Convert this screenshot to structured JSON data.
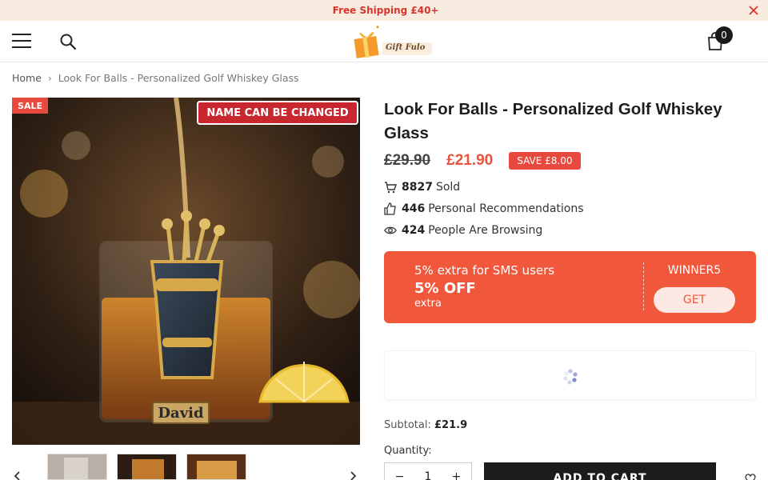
{
  "announcement": {
    "text": "​ Free Shipping £40+"
  },
  "header": {
    "logo_text": "Gift Fulo",
    "cart_count": "0"
  },
  "breadcrumb": {
    "home": "Home",
    "separator": "›",
    "current": "Look For Balls - Personalized Golf Whiskey Glass"
  },
  "product": {
    "sale_badge": "SALE",
    "image_banner": "NAME CAN BE CHANGED",
    "image_name": "David",
    "title": "Look For Balls - Personalized Golf Whiskey Glass",
    "price_old": "£29.90",
    "price_new": "£21.90",
    "save_badge": "SAVE £8.00",
    "stats": [
      {
        "icon": "cart-icon",
        "num": "8827",
        "label": "Sold"
      },
      {
        "icon": "thumbs-up-icon",
        "num": "446",
        "label": "Personal Recommendations"
      },
      {
        "icon": "eye-icon",
        "num": "424",
        "label": "People Are Browsing"
      }
    ]
  },
  "promo": {
    "line1": "5% extra for SMS users",
    "line2": "5% OFF",
    "line3": "extra",
    "code": "WINNER5",
    "button": "GET"
  },
  "purchase": {
    "subtotal_label": "Subtotal:",
    "subtotal_value": "£21.9",
    "quantity_label": "Quantity:",
    "quantity_value": "1",
    "minus": "−",
    "plus": "+",
    "add_to_cart": "ADD TO CART"
  },
  "colors": {
    "accent": "#e8493e",
    "promo": "#f0573b",
    "announce_bg": "#f8ece0"
  }
}
